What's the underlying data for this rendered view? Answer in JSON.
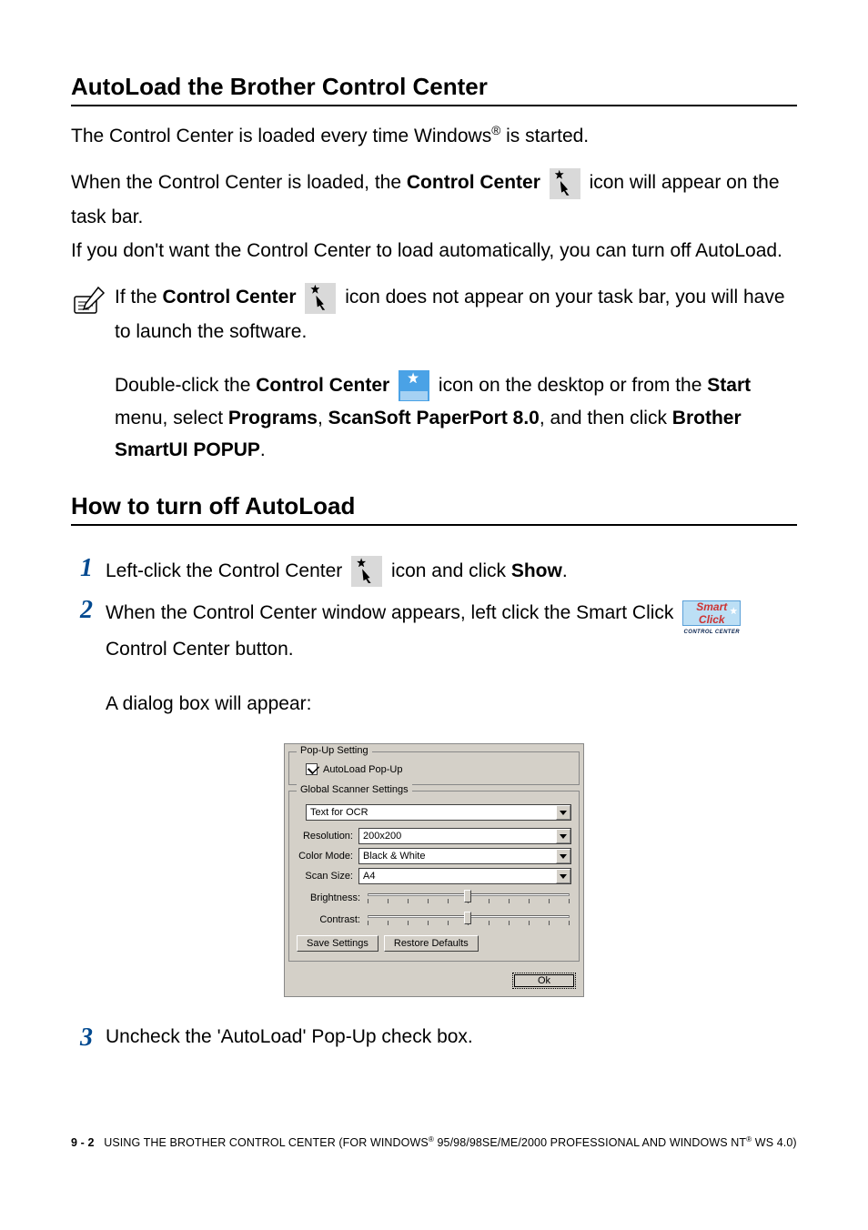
{
  "heading1": "AutoLoad the Brother Control Center",
  "p1_a": "The Control Center is loaded every time Windows",
  "p1_b": " is started.",
  "p2_a": "When the Control Center is loaded, the ",
  "p2_bold": "Control Center",
  "p2_c": " icon will appear on the task bar.",
  "p3": "If you don't want the Control Center to load automatically, you can turn off AutoLoad.",
  "note1_a": "If the ",
  "note1_bold": "Control Center",
  "note1_b": " icon does not appear on your task bar, you will have to launch the software.",
  "note2_a": "Double-click the ",
  "note2_bold1": "Control Center",
  "note2_b": " icon on the desktop or from the ",
  "note2_bold2": "Start",
  "note2_c": " menu, select ",
  "note2_bold3": "Programs",
  "note2_comma1": ", ",
  "note2_bold4": "ScanSoft PaperPort 8.0",
  "note2_d": ", and then click ",
  "note2_bold5": "Brother SmartUI POPUP",
  "note2_e": ".",
  "heading2": "How to turn off AutoLoad",
  "step1_a": "Left-click the Control Center ",
  "step1_b": " icon and click ",
  "step1_bold": "Show",
  "step1_c": ".",
  "step2_a": "When the Control Center window appears, left click the Smart Click ",
  "step2_b": " Control Center button.",
  "step2_sub": "A dialog box will appear:",
  "step3": "Uncheck the 'AutoLoad' Pop-Up check box.",
  "dialog": {
    "popup_group": "Pop-Up Setting",
    "autoload_label": "AutoLoad Pop-Up",
    "global_group": "Global Scanner Settings",
    "preset": "Text for OCR",
    "resolution_label": "Resolution:",
    "resolution_value": "200x200",
    "colormode_label": "Color Mode:",
    "colormode_value": "Black & White",
    "scansize_label": "Scan Size:",
    "scansize_value": "A4",
    "brightness_label": "Brightness:",
    "contrast_label": "Contrast:",
    "save_btn": "Save Settings",
    "restore_btn": "Restore Defaults",
    "ok_btn": "Ok"
  },
  "footer_page": "9 - 2",
  "footer_a": "USING THE BROTHER CONTROL CENTER (FOR WINDOWS",
  "footer_b": " 95/98/98SE/ME/2000 PROFESSIONAL AND WINDOWS NT",
  "footer_c": " WS 4.0)",
  "smartclick_top": "Smart Click",
  "smartclick_bot": "CONTROL CENTER"
}
